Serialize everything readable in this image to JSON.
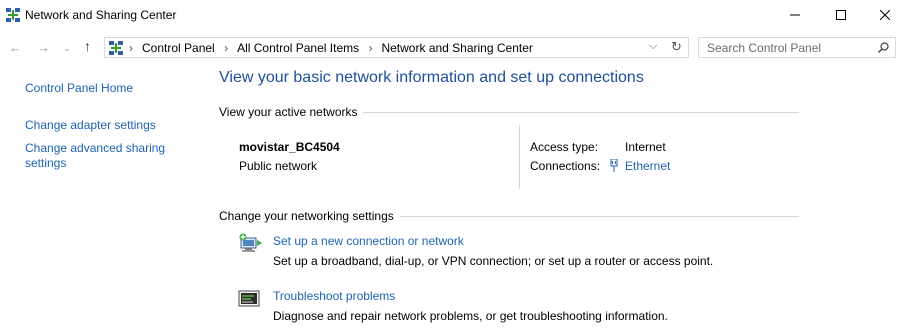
{
  "window": {
    "title": "Network and Sharing Center",
    "controls": {
      "minimize": "minimize-icon",
      "maximize": "maximize-icon",
      "close": "close-icon"
    }
  },
  "address_bar": {
    "breadcrumbs": [
      "Control Panel",
      "All Control Panel Items",
      "Network and Sharing Center"
    ],
    "search_placeholder": "Search Control Panel"
  },
  "sidebar": {
    "items": [
      {
        "label": "Control Panel Home"
      },
      {
        "label": "Change adapter settings"
      },
      {
        "label": "Change advanced sharing settings"
      }
    ]
  },
  "main": {
    "heading": "View your basic network information and set up connections",
    "active_networks_header": "View your active networks",
    "network": {
      "name": "movistar_BC4504",
      "type": "Public network",
      "access_type_label": "Access type:",
      "access_type_value": "Internet",
      "connections_label": "Connections:",
      "connections_value": "Ethernet"
    },
    "change_settings_header": "Change your networking settings",
    "tasks": [
      {
        "title": "Set up a new connection or network",
        "description": "Set up a broadband, dial-up, or VPN connection; or set up a router or access point."
      },
      {
        "title": "Troubleshoot problems",
        "description": "Diagnose and repair network problems, or get troubleshooting information."
      }
    ]
  },
  "colors": {
    "link": "#1e62b5",
    "heading": "#1e4f9c",
    "rule": "#d6d6d6"
  }
}
